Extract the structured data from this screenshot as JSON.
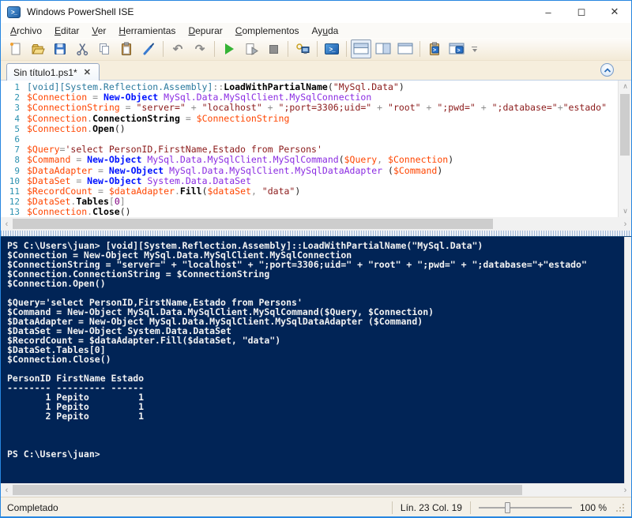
{
  "window": {
    "title": "Windows PowerShell ISE",
    "controls": {
      "minimize": "–",
      "maximize": "◻",
      "close": "✕"
    }
  },
  "menu": {
    "items": [
      {
        "label": "Archivo",
        "accel": 0
      },
      {
        "label": "Editar",
        "accel": 0
      },
      {
        "label": "Ver",
        "accel": 0
      },
      {
        "label": "Herramientas",
        "accel": 0
      },
      {
        "label": "Depurar",
        "accel": 0
      },
      {
        "label": "Complementos",
        "accel": 0
      },
      {
        "label": "Ayuda",
        "accel": 2
      }
    ]
  },
  "toolbar": {
    "icons": [
      "new-script",
      "open-script",
      "save-script",
      "cut",
      "copy",
      "paste",
      "clear-console",
      "undo",
      "redo",
      "run-script",
      "run-selection",
      "stop-operation",
      "new-remote-powershell-tab",
      "start-powershell",
      "show-script-pane-top",
      "show-script-pane-right",
      "show-script-pane-maximized",
      "addon-command-clipboard",
      "addon-command-window",
      "toolbar-overflow"
    ],
    "undo_glyph": "↶",
    "redo_glyph": "↷",
    "selected_layout": "show-script-pane-top"
  },
  "tabs": {
    "active_label": "Sin título1.ps1*",
    "close_glyph": "✕"
  },
  "editor": {
    "lines": [
      {
        "n": 1,
        "tokens": [
          [
            "type",
            "[void][System.Reflection.Assembly]"
          ],
          [
            "op",
            "::"
          ],
          [
            "member",
            "LoadWithPartialName"
          ],
          [
            "plain",
            "("
          ],
          [
            "string",
            "\"MySql.Data\""
          ],
          [
            "plain",
            ")"
          ]
        ]
      },
      {
        "n": 2,
        "tokens": [
          [
            "var",
            "$Connection"
          ],
          [
            "op",
            " = "
          ],
          [
            "cmdlet",
            "New-Object"
          ],
          [
            "plain",
            " "
          ],
          [
            "typename",
            "MySql.Data.MySqlClient.MySqlConnection"
          ]
        ]
      },
      {
        "n": 3,
        "tokens": [
          [
            "var",
            "$ConnectionString"
          ],
          [
            "op",
            " = "
          ],
          [
            "string",
            "\"server=\""
          ],
          [
            "op",
            " + "
          ],
          [
            "string",
            "\"localhost\""
          ],
          [
            "op",
            " + "
          ],
          [
            "string",
            "\";port=3306;uid=\""
          ],
          [
            "op",
            " + "
          ],
          [
            "string",
            "\"root\""
          ],
          [
            "op",
            " + "
          ],
          [
            "string",
            "\";pwd=\""
          ],
          [
            "op",
            " + "
          ],
          [
            "string",
            "\";database=\""
          ],
          [
            "op",
            "+"
          ],
          [
            "string",
            "\"estado\""
          ]
        ]
      },
      {
        "n": 4,
        "tokens": [
          [
            "var",
            "$Connection"
          ],
          [
            "op",
            "."
          ],
          [
            "member",
            "ConnectionString"
          ],
          [
            "op",
            " = "
          ],
          [
            "var",
            "$ConnectionString"
          ]
        ]
      },
      {
        "n": 5,
        "tokens": [
          [
            "var",
            "$Connection"
          ],
          [
            "op",
            "."
          ],
          [
            "member",
            "Open"
          ],
          [
            "plain",
            "()"
          ]
        ]
      },
      {
        "n": 6,
        "tokens": []
      },
      {
        "n": 7,
        "tokens": [
          [
            "var",
            "$Query"
          ],
          [
            "op",
            "="
          ],
          [
            "string",
            "'select PersonID,FirstName,Estado from Persons'"
          ]
        ]
      },
      {
        "n": 8,
        "tokens": [
          [
            "var",
            "$Command"
          ],
          [
            "op",
            " = "
          ],
          [
            "cmdlet",
            "New-Object"
          ],
          [
            "plain",
            " "
          ],
          [
            "typename",
            "MySql.Data.MySqlClient.MySqlCommand"
          ],
          [
            "plain",
            "("
          ],
          [
            "var",
            "$Query"
          ],
          [
            "op",
            ", "
          ],
          [
            "var",
            "$Connection"
          ],
          [
            "plain",
            ")"
          ]
        ]
      },
      {
        "n": 9,
        "tokens": [
          [
            "var",
            "$DataAdapter"
          ],
          [
            "op",
            " = "
          ],
          [
            "cmdlet",
            "New-Object"
          ],
          [
            "plain",
            " "
          ],
          [
            "typename",
            "MySql.Data.MySqlClient.MySqlDataAdapter"
          ],
          [
            "plain",
            " ("
          ],
          [
            "var",
            "$Command"
          ],
          [
            "plain",
            ")"
          ]
        ]
      },
      {
        "n": 10,
        "tokens": [
          [
            "var",
            "$DataSet"
          ],
          [
            "op",
            " = "
          ],
          [
            "cmdlet",
            "New-Object"
          ],
          [
            "plain",
            " "
          ],
          [
            "typename",
            "System.Data.DataSet"
          ]
        ]
      },
      {
        "n": 11,
        "tokens": [
          [
            "var",
            "$RecordCount"
          ],
          [
            "op",
            " = "
          ],
          [
            "var",
            "$dataAdapter"
          ],
          [
            "op",
            "."
          ],
          [
            "member",
            "Fill"
          ],
          [
            "plain",
            "("
          ],
          [
            "var",
            "$dataSet"
          ],
          [
            "op",
            ", "
          ],
          [
            "string",
            "\"data\""
          ],
          [
            "plain",
            ")"
          ]
        ]
      },
      {
        "n": 12,
        "tokens": [
          [
            "var",
            "$DataSet"
          ],
          [
            "op",
            "."
          ],
          [
            "member",
            "Tables"
          ],
          [
            "op",
            "["
          ],
          [
            "number",
            "0"
          ],
          [
            "op",
            "]"
          ]
        ]
      },
      {
        "n": 13,
        "tokens": [
          [
            "var",
            "$Connection"
          ],
          [
            "op",
            "."
          ],
          [
            "member",
            "Close"
          ],
          [
            "plain",
            "()"
          ]
        ]
      }
    ]
  },
  "console": {
    "lines": [
      "PS C:\\Users\\juan> [void][System.Reflection.Assembly]::LoadWithPartialName(\"MySql.Data\")",
      "$Connection = New-Object MySql.Data.MySqlClient.MySqlConnection",
      "$ConnectionString = \"server=\" + \"localhost\" + \";port=3306;uid=\" + \"root\" + \";pwd=\" + \";database=\"+\"estado\"",
      "$Connection.ConnectionString = $ConnectionString",
      "$Connection.Open()",
      "",
      "$Query='select PersonID,FirstName,Estado from Persons'",
      "$Command = New-Object MySql.Data.MySqlClient.MySqlCommand($Query, $Connection)",
      "$DataAdapter = New-Object MySql.Data.MySqlClient.MySqlDataAdapter ($Command)",
      "$DataSet = New-Object System.Data.DataSet",
      "$RecordCount = $dataAdapter.Fill($dataSet, \"data\")",
      "$DataSet.Tables[0]",
      "$Connection.Close()",
      "",
      "PersonID FirstName Estado",
      "-------- --------- ------",
      "       1 Pepito         1",
      "       1 Pepito         1",
      "       2 Pepito         1",
      "",
      "",
      "",
      "PS C:\\Users\\juan>"
    ],
    "table": {
      "headers": [
        "PersonID",
        "FirstName",
        "Estado"
      ],
      "rows": [
        [
          "1",
          "Pepito",
          "1"
        ],
        [
          "1",
          "Pepito",
          "1"
        ],
        [
          "2",
          "Pepito",
          "1"
        ]
      ]
    },
    "prompt": "PS C:\\Users\\juan>"
  },
  "statusbar": {
    "status": "Completado",
    "position": "Lín. 23 Col. 19",
    "zoom": "100 %"
  },
  "colors": {
    "accent_border": "#2786e0",
    "console_bg": "#012456",
    "console_fg": "#f2f2f2",
    "line_number": "#2b91af",
    "token_variable": "#ff4500",
    "token_cmdlet": "#0012ff",
    "token_string": "#8b1a1a",
    "token_type": "#2b7a9e",
    "token_argument": "#8a2be2",
    "token_operator": "#8c8c8c",
    "token_number": "#800080",
    "run_green": "#35b335"
  }
}
